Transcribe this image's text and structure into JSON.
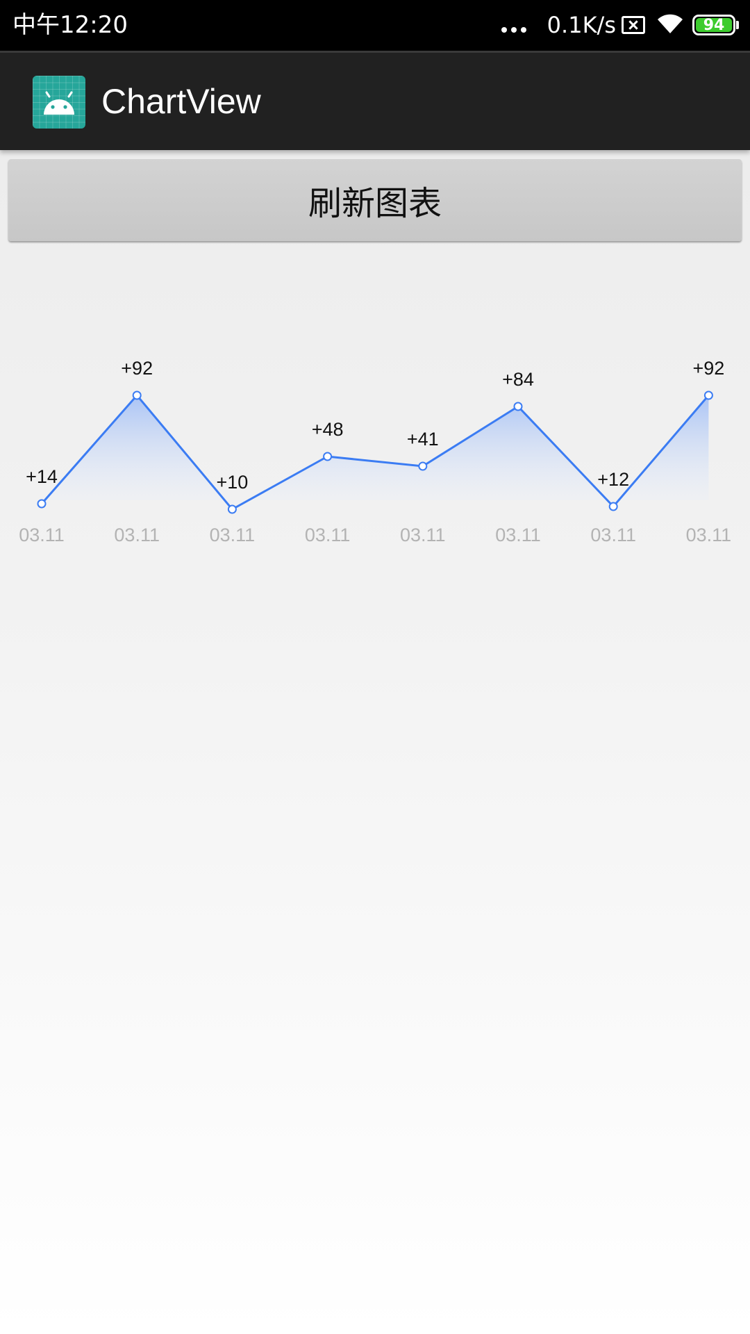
{
  "status_bar": {
    "time": "中午12:20",
    "net_speed": "0.1K/s",
    "battery_level": "94"
  },
  "app_bar": {
    "title": "ChartView"
  },
  "actions": {
    "refresh_label": "刷新图表"
  },
  "colors": {
    "line": "#3b7cf3",
    "fill_top": "#a9c3f5",
    "x_label": "#b3b3b3",
    "value_label": "#111111"
  },
  "chart_data": {
    "type": "area",
    "categories": [
      "03.11",
      "03.11",
      "03.11",
      "03.11",
      "03.11",
      "03.11",
      "03.11",
      "03.11"
    ],
    "values": [
      14,
      92,
      10,
      48,
      41,
      84,
      12,
      92
    ],
    "labels": [
      "+14",
      "+92",
      "+10",
      "+48",
      "+41",
      "+84",
      "+12",
      "+92"
    ],
    "title": "",
    "xlabel": "",
    "ylabel": "",
    "grid": false
  }
}
